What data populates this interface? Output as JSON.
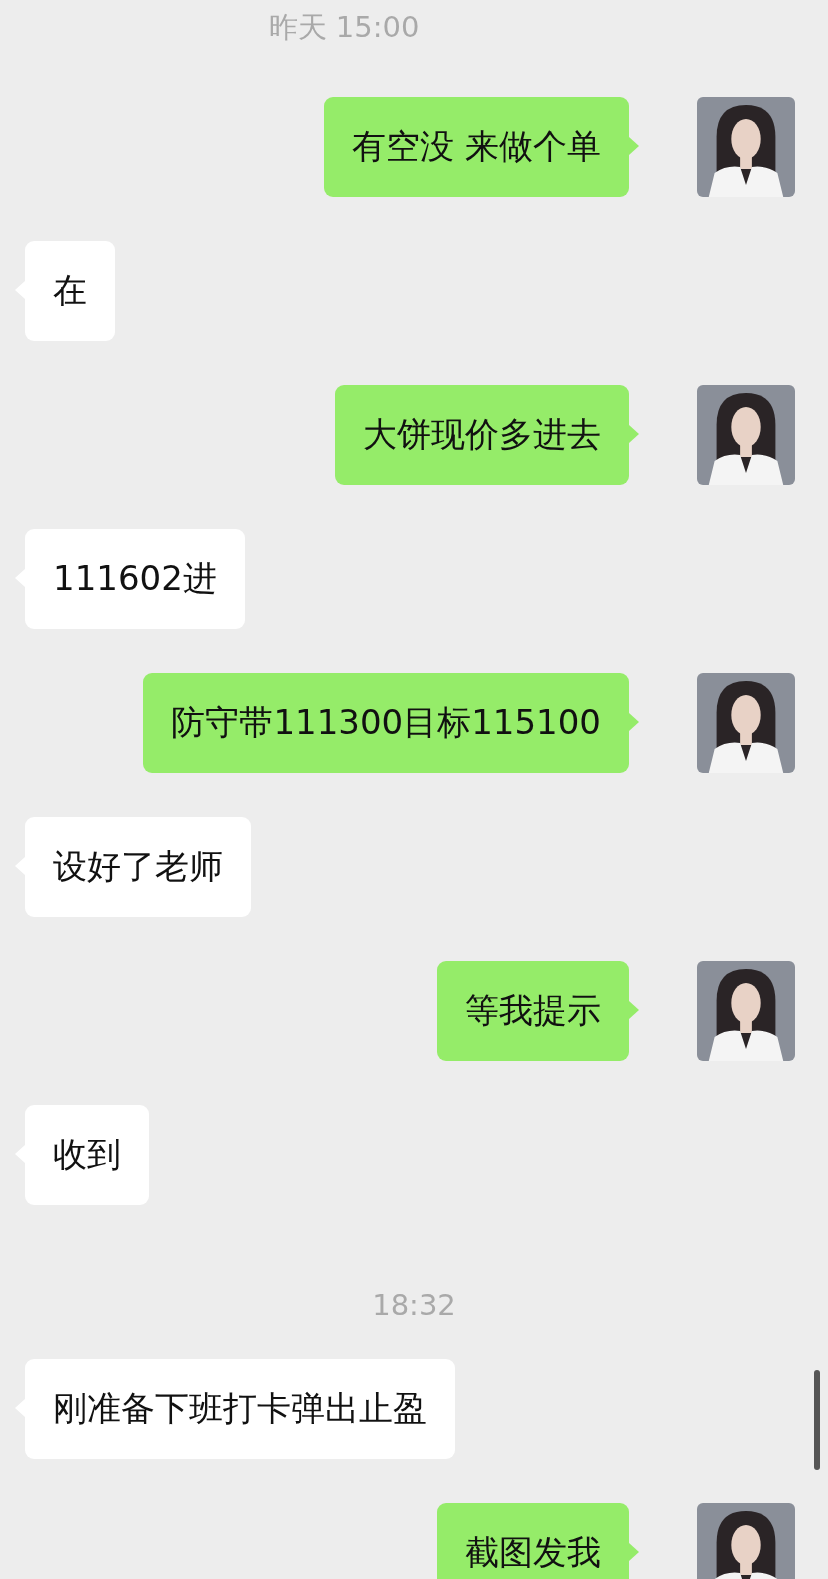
{
  "messages": [
    {
      "kind": "time",
      "text": "昨天 15:00"
    },
    {
      "kind": "outgoing",
      "text": "有空没 来做个单"
    },
    {
      "kind": "incoming",
      "text": "在"
    },
    {
      "kind": "outgoing",
      "text": "大饼现价多进去"
    },
    {
      "kind": "incoming",
      "text": "111602进"
    },
    {
      "kind": "outgoing",
      "text": "防守带111300目标115100"
    },
    {
      "kind": "incoming",
      "text": "设好了老师"
    },
    {
      "kind": "outgoing",
      "text": "等我提示"
    },
    {
      "kind": "incoming",
      "text": "收到"
    },
    {
      "kind": "time",
      "text": "18:32"
    },
    {
      "kind": "incoming",
      "text": "刚准备下班打卡弹出止盈"
    },
    {
      "kind": "outgoing",
      "text": "截图发我"
    }
  ]
}
